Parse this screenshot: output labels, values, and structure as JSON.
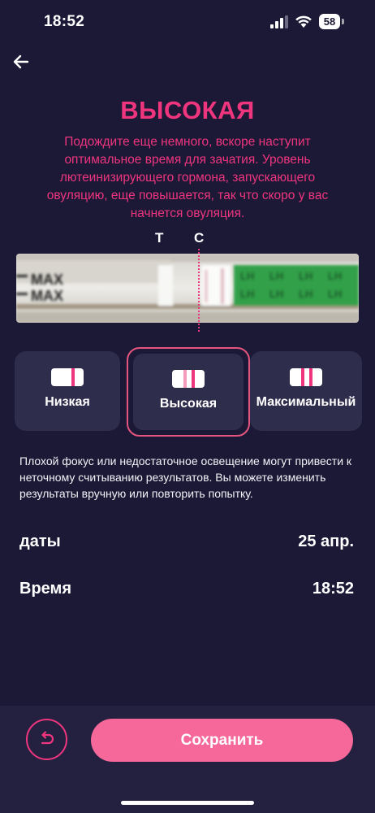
{
  "status_bar": {
    "time": "18:52",
    "battery": "58"
  },
  "header": {
    "back_icon": "arrow-left-icon"
  },
  "result": {
    "title": "ВЫСОКАЯ",
    "description": "Подождите еще немного, вскоре наступит оптимальное время для зачатия. Уровень лютеинизирующего гормона, запускающего овуляцию, еще повышается, так что скоро у вас начнется овуляция."
  },
  "strip": {
    "label_t": "T",
    "label_c": "C",
    "max_text_1": "MAX",
    "max_text_2": "MAX",
    "lh_text": "LH"
  },
  "levels": {
    "selected": "Высокая",
    "items": [
      {
        "label": "Низкая"
      },
      {
        "label": "Высокая"
      },
      {
        "label": "Максимальный"
      }
    ]
  },
  "warning": "Плохой фокус или недостаточное освещение могут привести к неточному считыванию результатов. Вы можете изменить результаты вручную или повторить попытку.",
  "details": {
    "date_label": "даты",
    "date_value": "25 апр.",
    "time_label": "Время",
    "time_value": "18:52"
  },
  "actions": {
    "undo_icon": "undo-icon",
    "save_label": "Сохранить"
  },
  "colors": {
    "background": "#1b1936",
    "accent": "#f0357f",
    "card": "#2f2d4c",
    "save_button": "#f56899"
  }
}
